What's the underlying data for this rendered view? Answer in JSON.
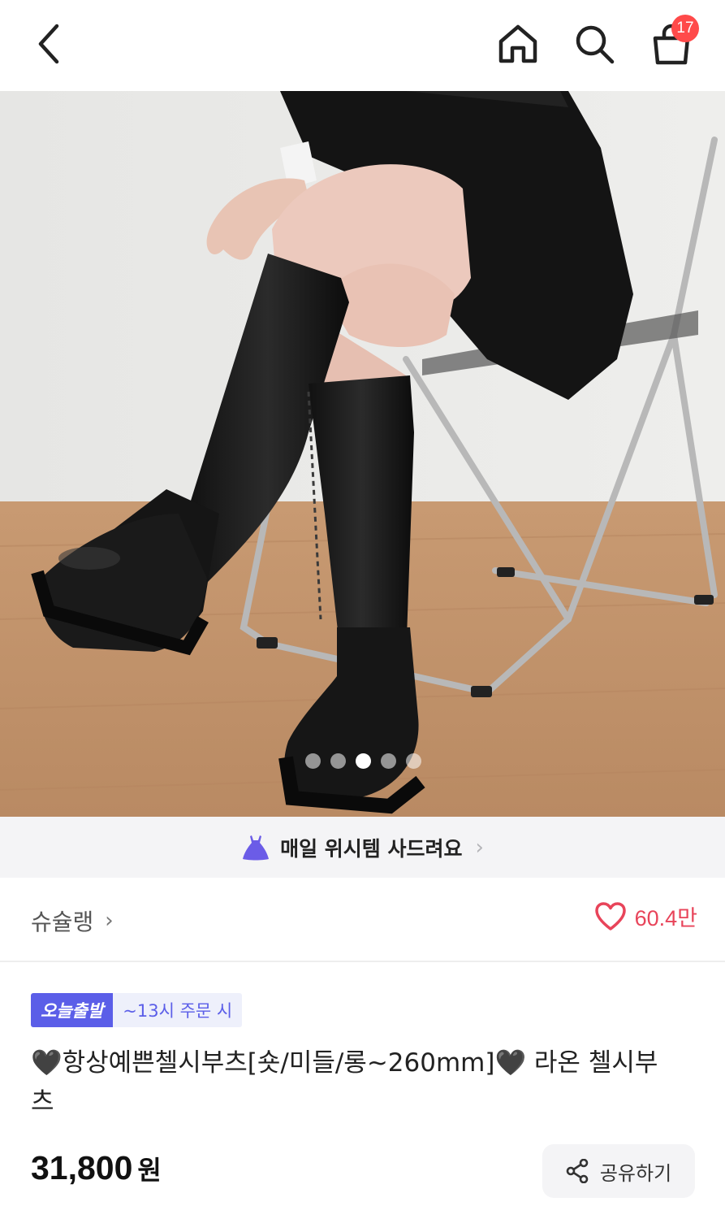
{
  "header": {
    "back_icon": "chevron-left-icon",
    "home_icon": "home-icon",
    "search_icon": "search-icon",
    "cart_icon": "shopping-bag-icon",
    "cart_count": "17"
  },
  "gallery": {
    "image_count": 5,
    "active_index": 2,
    "expand_icon": "expand-icon"
  },
  "banner": {
    "icon": "dress-icon",
    "text": "매일 위시템 사드려요",
    "chevron": "›"
  },
  "store": {
    "name": "슈슐랭",
    "chevron": "›",
    "like_count": "60.4만",
    "like_icon": "heart-icon"
  },
  "product": {
    "badge_today": "오늘출발",
    "badge_time": "~13시 주문 시",
    "title": "🖤항상예쁜첼시부츠[숏/미들/롱~260mm]🖤 라온 첼시부츠",
    "price": "31,800",
    "price_unit": "원",
    "share_label": "공유하기"
  },
  "colors": {
    "accent": "#5b5ee8",
    "badge_red": "#ff4a4a",
    "like_red": "#e8445a",
    "banner_bg": "#f4f4f6"
  }
}
